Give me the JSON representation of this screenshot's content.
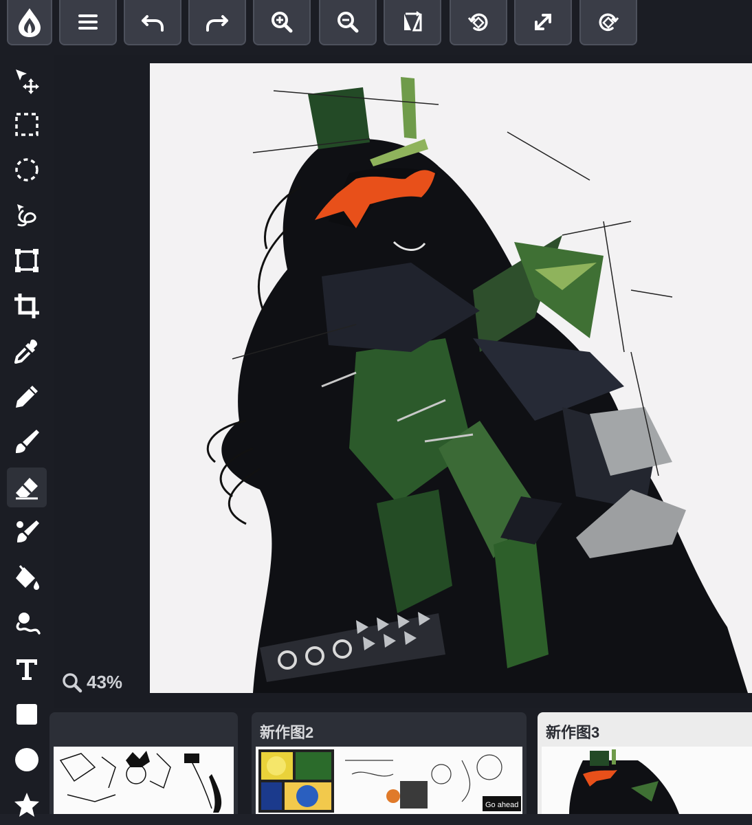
{
  "toolbar": {
    "buttons": [
      {
        "icon": "menu-icon"
      },
      {
        "icon": "undo-icon"
      },
      {
        "icon": "redo-icon"
      },
      {
        "icon": "zoom-in-icon"
      },
      {
        "icon": "zoom-out-icon"
      },
      {
        "icon": "flip-icon"
      },
      {
        "icon": "rotate-left-icon"
      },
      {
        "icon": "fullscreen-icon"
      },
      {
        "icon": "rotate-right-icon"
      }
    ]
  },
  "tools": [
    {
      "icon": "move-icon"
    },
    {
      "icon": "rect-select-icon"
    },
    {
      "icon": "ellipse-select-icon"
    },
    {
      "icon": "lasso-icon"
    },
    {
      "icon": "transform-icon"
    },
    {
      "icon": "crop-icon"
    },
    {
      "icon": "eyedropper-icon"
    },
    {
      "icon": "pencil-icon"
    },
    {
      "icon": "brush-icon"
    },
    {
      "icon": "eraser-icon",
      "active": true
    },
    {
      "icon": "blend-brush-icon"
    },
    {
      "icon": "fill-icon"
    },
    {
      "icon": "smudge-icon"
    },
    {
      "icon": "text-icon"
    },
    {
      "icon": "rectangle-shape-icon"
    },
    {
      "icon": "ellipse-shape-icon"
    },
    {
      "icon": "star-shape-icon"
    }
  ],
  "canvas": {
    "zoom_label": "43%"
  },
  "documents": [
    {
      "title": "",
      "active": false
    },
    {
      "title": "新作图2",
      "active": false
    },
    {
      "title": "新作图3",
      "active": true
    }
  ],
  "thumbnail_text": {
    "doc2_caption": "Go ahead"
  },
  "colors": {
    "toolbar_bg": "#1b1d24",
    "button_bg": "#3a3d47",
    "canvas_bg": "#f3f2f3",
    "accent_orange": "#e8501a",
    "accent_green": "#3d6b3a"
  }
}
